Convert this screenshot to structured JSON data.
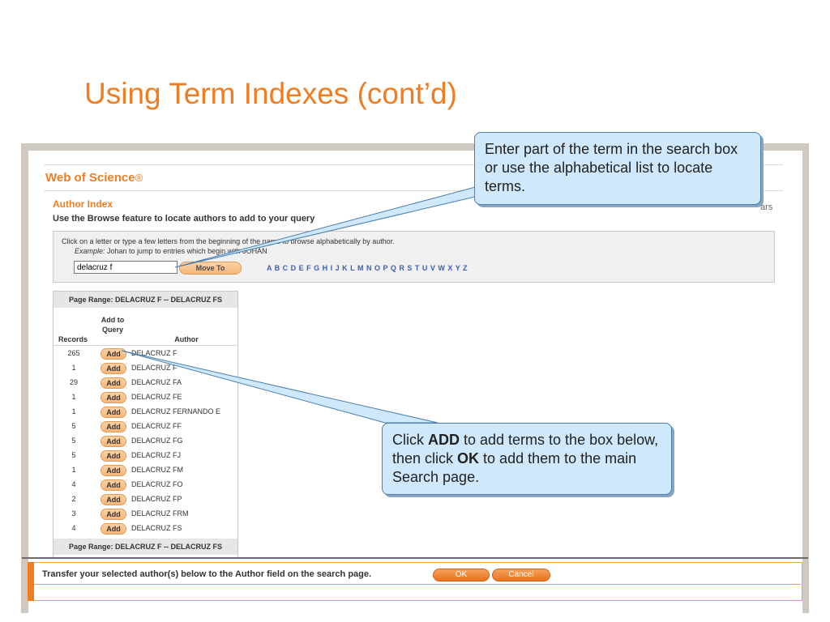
{
  "slide": {
    "title": "Using Term Indexes (cont’d)"
  },
  "app": {
    "title": "Web of Science",
    "title_mark": "®",
    "section": "Author Index",
    "instructions": "Use the Browse feature to locate authors to add to your query",
    "years_stub": "ars"
  },
  "browse": {
    "line1": "Click on a letter or type a few letters from the beginning of the name to browse alphabetically by author.",
    "example_label": "Example:",
    "example_text": " Johan to jump to entries which begin with JOHAN",
    "search_value": "delacruz f",
    "move_to_label": "Move To",
    "alphabet": "A B C D E F G H I J K L M N O P Q R S T U V W X Y Z"
  },
  "results": {
    "page_range_top": "Page Range: DELACRUZ F -- DELACRUZ FS",
    "page_range_bottom": "Page Range: DELACRUZ F -- DELACRUZ FS",
    "col_records": "Records",
    "col_add": "Add to Query",
    "col_author": "Author",
    "add_label": "Add",
    "rows": [
      {
        "count": "265",
        "author": "DELACRUZ F"
      },
      {
        "count": "1",
        "author": "DELACRUZ F"
      },
      {
        "count": "29",
        "author": "DELACRUZ FA"
      },
      {
        "count": "1",
        "author": "DELACRUZ FE"
      },
      {
        "count": "1",
        "author": "DELACRUZ FERNANDO E"
      },
      {
        "count": "5",
        "author": "DELACRUZ FF"
      },
      {
        "count": "5",
        "author": "DELACRUZ FG"
      },
      {
        "count": "5",
        "author": "DELACRUZ FJ"
      },
      {
        "count": "1",
        "author": "DELACRUZ FM"
      },
      {
        "count": "4",
        "author": "DELACRUZ FO"
      },
      {
        "count": "2",
        "author": "DELACRUZ FP"
      },
      {
        "count": "3",
        "author": "DELACRUZ FRM"
      },
      {
        "count": "4",
        "author": "DELACRUZ FS"
      }
    ]
  },
  "transfer": {
    "text": "Transfer your selected author(s) below to the Author field on the search page.",
    "ok_label": "OK",
    "cancel_label": "Cancel"
  },
  "callouts": {
    "top": "Enter part of the term in the search box or use the alphabetical list to locate terms.",
    "bottom_p1": "Click ",
    "bottom_b1": "ADD",
    "bottom_p2": " to add terms to the box below, then click ",
    "bottom_b2": "OK",
    "bottom_p3": " to add them to the main Search page."
  }
}
